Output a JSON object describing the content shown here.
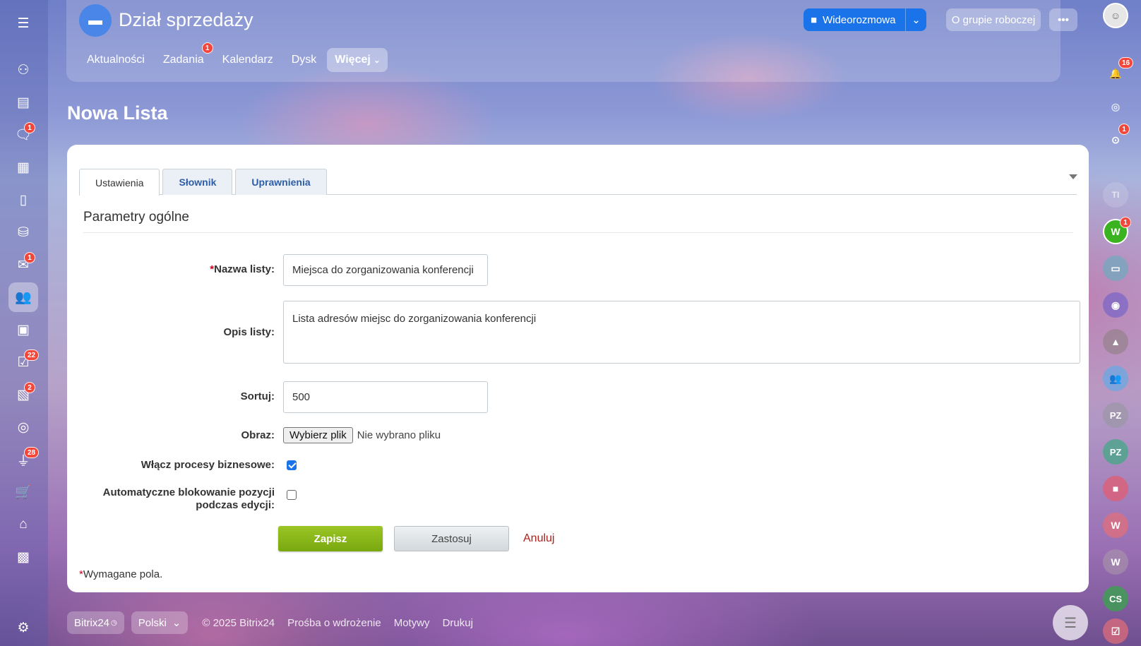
{
  "header": {
    "group_title": "Dział sprzedaży",
    "nav": [
      {
        "label": "Aktualności"
      },
      {
        "label": "Zadania",
        "badge": "1"
      },
      {
        "label": "Kalendarz"
      },
      {
        "label": "Dysk"
      },
      {
        "label": "Więcej",
        "active": true
      }
    ],
    "video_button": "Wideorozmowa",
    "about_button": "O grupie roboczej",
    "more_button": "•••"
  },
  "page_title": "Nowa Lista",
  "tabs": [
    {
      "label": "Ustawienia",
      "active": true
    },
    {
      "label": "Słownik"
    },
    {
      "label": "Uprawnienia"
    }
  ],
  "form": {
    "section_title": "Parametry ogólne",
    "name_label": "Nazwa listy:",
    "name_value": "Miejsca do zorganizowania konferencji",
    "description_label": "Opis listy:",
    "description_value": "Lista adresów miejsc do zorganizowania konferencji",
    "sort_label": "Sortuj:",
    "sort_value": "500",
    "image_label": "Obraz:",
    "file_button": "Wybierz plik",
    "file_status": "Nie wybrano pliku",
    "bp_label": "Włącz procesy biznesowe:",
    "bp_checked": true,
    "lock_label_1": "Automatyczne blokowanie pozycji",
    "lock_label_2": "podczas edycji:",
    "lock_checked": false,
    "save": "Zapisz",
    "apply": "Zastosuj",
    "cancel": "Anuluj",
    "required_mark": "*",
    "required_note": "Wymagane pola."
  },
  "left_sidebar": {
    "badges": {
      "chat": "1",
      "mail": "1",
      "tasks": "22",
      "news": "2",
      "filter": "28"
    }
  },
  "right_sidebar": {
    "notifications_badge": "16",
    "chat_badge": "1",
    "avatars": [
      {
        "initials": "TI"
      },
      {
        "initials": "W",
        "badge": "1"
      },
      {
        "initials": "PZ"
      },
      {
        "initials": "PZ"
      },
      {
        "initials": "W"
      },
      {
        "initials": "W"
      },
      {
        "initials": "CS"
      }
    ]
  },
  "footer": {
    "brand": "Bitrix24",
    "language": "Polski",
    "copyright": "© 2025 Bitrix24",
    "link_implementation": "Prośba o wdrożenie",
    "link_themes": "Motywy",
    "link_print": "Drukuj"
  },
  "colors": {
    "accent_blue": "#1a73e8",
    "save_green": "#79a80f",
    "badge_red": "#f3473c",
    "cancel_red": "#b0201a"
  }
}
